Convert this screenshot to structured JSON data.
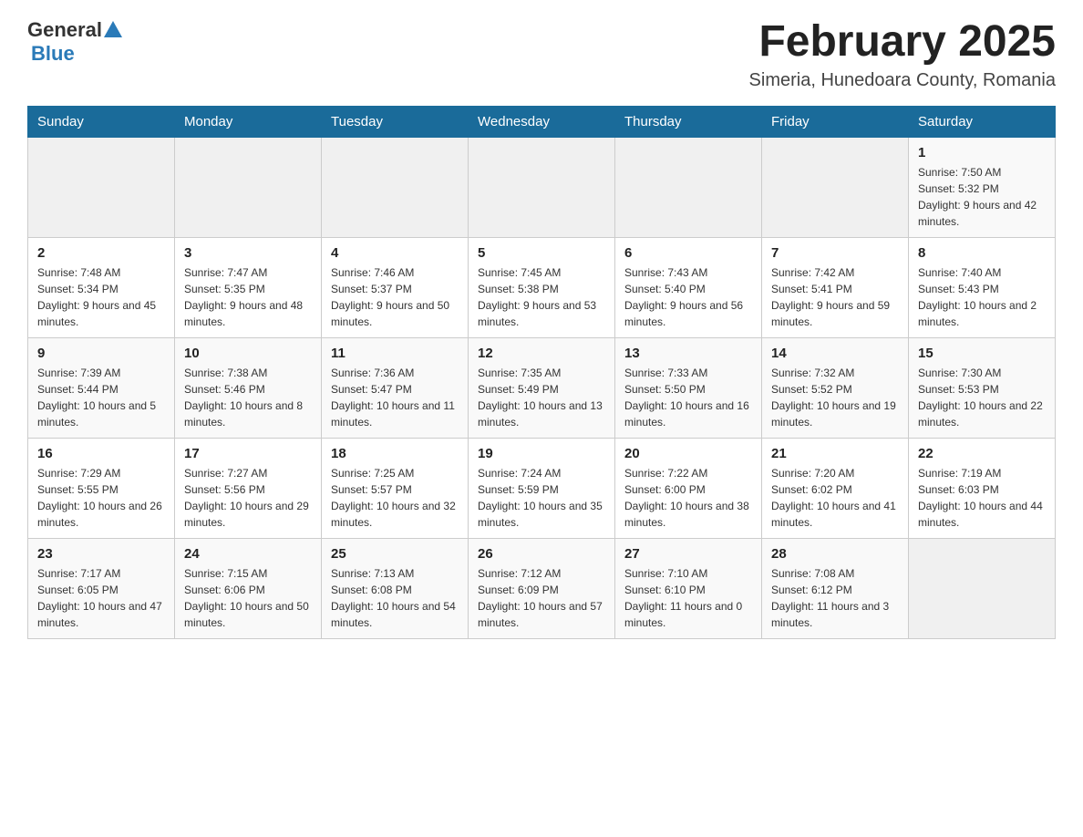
{
  "header": {
    "logo_general": "General",
    "logo_blue": "Blue",
    "month_title": "February 2025",
    "location": "Simeria, Hunedoara County, Romania"
  },
  "days_of_week": [
    "Sunday",
    "Monday",
    "Tuesday",
    "Wednesday",
    "Thursday",
    "Friday",
    "Saturday"
  ],
  "weeks": [
    [
      {
        "day": "",
        "info": ""
      },
      {
        "day": "",
        "info": ""
      },
      {
        "day": "",
        "info": ""
      },
      {
        "day": "",
        "info": ""
      },
      {
        "day": "",
        "info": ""
      },
      {
        "day": "",
        "info": ""
      },
      {
        "day": "1",
        "info": "Sunrise: 7:50 AM\nSunset: 5:32 PM\nDaylight: 9 hours and 42 minutes."
      }
    ],
    [
      {
        "day": "2",
        "info": "Sunrise: 7:48 AM\nSunset: 5:34 PM\nDaylight: 9 hours and 45 minutes."
      },
      {
        "day": "3",
        "info": "Sunrise: 7:47 AM\nSunset: 5:35 PM\nDaylight: 9 hours and 48 minutes."
      },
      {
        "day": "4",
        "info": "Sunrise: 7:46 AM\nSunset: 5:37 PM\nDaylight: 9 hours and 50 minutes."
      },
      {
        "day": "5",
        "info": "Sunrise: 7:45 AM\nSunset: 5:38 PM\nDaylight: 9 hours and 53 minutes."
      },
      {
        "day": "6",
        "info": "Sunrise: 7:43 AM\nSunset: 5:40 PM\nDaylight: 9 hours and 56 minutes."
      },
      {
        "day": "7",
        "info": "Sunrise: 7:42 AM\nSunset: 5:41 PM\nDaylight: 9 hours and 59 minutes."
      },
      {
        "day": "8",
        "info": "Sunrise: 7:40 AM\nSunset: 5:43 PM\nDaylight: 10 hours and 2 minutes."
      }
    ],
    [
      {
        "day": "9",
        "info": "Sunrise: 7:39 AM\nSunset: 5:44 PM\nDaylight: 10 hours and 5 minutes."
      },
      {
        "day": "10",
        "info": "Sunrise: 7:38 AM\nSunset: 5:46 PM\nDaylight: 10 hours and 8 minutes."
      },
      {
        "day": "11",
        "info": "Sunrise: 7:36 AM\nSunset: 5:47 PM\nDaylight: 10 hours and 11 minutes."
      },
      {
        "day": "12",
        "info": "Sunrise: 7:35 AM\nSunset: 5:49 PM\nDaylight: 10 hours and 13 minutes."
      },
      {
        "day": "13",
        "info": "Sunrise: 7:33 AM\nSunset: 5:50 PM\nDaylight: 10 hours and 16 minutes."
      },
      {
        "day": "14",
        "info": "Sunrise: 7:32 AM\nSunset: 5:52 PM\nDaylight: 10 hours and 19 minutes."
      },
      {
        "day": "15",
        "info": "Sunrise: 7:30 AM\nSunset: 5:53 PM\nDaylight: 10 hours and 22 minutes."
      }
    ],
    [
      {
        "day": "16",
        "info": "Sunrise: 7:29 AM\nSunset: 5:55 PM\nDaylight: 10 hours and 26 minutes."
      },
      {
        "day": "17",
        "info": "Sunrise: 7:27 AM\nSunset: 5:56 PM\nDaylight: 10 hours and 29 minutes."
      },
      {
        "day": "18",
        "info": "Sunrise: 7:25 AM\nSunset: 5:57 PM\nDaylight: 10 hours and 32 minutes."
      },
      {
        "day": "19",
        "info": "Sunrise: 7:24 AM\nSunset: 5:59 PM\nDaylight: 10 hours and 35 minutes."
      },
      {
        "day": "20",
        "info": "Sunrise: 7:22 AM\nSunset: 6:00 PM\nDaylight: 10 hours and 38 minutes."
      },
      {
        "day": "21",
        "info": "Sunrise: 7:20 AM\nSunset: 6:02 PM\nDaylight: 10 hours and 41 minutes."
      },
      {
        "day": "22",
        "info": "Sunrise: 7:19 AM\nSunset: 6:03 PM\nDaylight: 10 hours and 44 minutes."
      }
    ],
    [
      {
        "day": "23",
        "info": "Sunrise: 7:17 AM\nSunset: 6:05 PM\nDaylight: 10 hours and 47 minutes."
      },
      {
        "day": "24",
        "info": "Sunrise: 7:15 AM\nSunset: 6:06 PM\nDaylight: 10 hours and 50 minutes."
      },
      {
        "day": "25",
        "info": "Sunrise: 7:13 AM\nSunset: 6:08 PM\nDaylight: 10 hours and 54 minutes."
      },
      {
        "day": "26",
        "info": "Sunrise: 7:12 AM\nSunset: 6:09 PM\nDaylight: 10 hours and 57 minutes."
      },
      {
        "day": "27",
        "info": "Sunrise: 7:10 AM\nSunset: 6:10 PM\nDaylight: 11 hours and 0 minutes."
      },
      {
        "day": "28",
        "info": "Sunrise: 7:08 AM\nSunset: 6:12 PM\nDaylight: 11 hours and 3 minutes."
      },
      {
        "day": "",
        "info": ""
      }
    ]
  ]
}
